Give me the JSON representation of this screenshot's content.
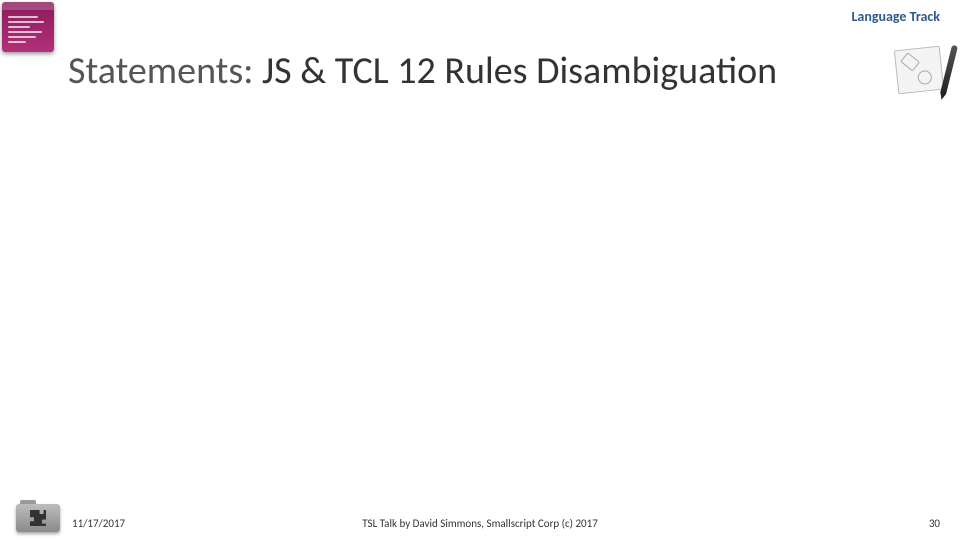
{
  "header": {
    "track_label": "Language Track"
  },
  "title": {
    "prefix": "Statements:",
    "rest": " JS & TCL 12 Rules Disambiguation"
  },
  "footer": {
    "date": "11/17/2017",
    "center": "TSL Talk by David Simmons, Smallscript Corp (c) 2017",
    "page": "30"
  }
}
